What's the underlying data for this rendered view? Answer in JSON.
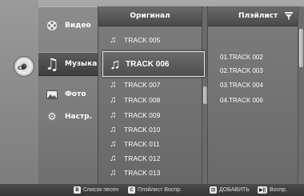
{
  "left": {
    "disc_label": "CD",
    "disc_icon": "cd-disc-icon"
  },
  "menu": {
    "items": [
      {
        "label": "Видео",
        "icon": "film-reel-icon",
        "active": false
      },
      {
        "label": "Музыка",
        "icon": "music-note-icon",
        "active": true
      },
      {
        "label": "Фото",
        "icon": "photo-icon",
        "active": false
      },
      {
        "label": "Настр.",
        "icon": "gear-icon",
        "active": false
      }
    ]
  },
  "original": {
    "title": "Оригинал",
    "tracks": [
      "TRACK 005",
      "TRACK 006",
      "TRACK 007",
      "TRACK 008",
      "TRACK 009",
      "TRACK 010",
      "TRACK 011",
      "TRACK 012",
      "TRACK 013"
    ],
    "selected_index": 1
  },
  "playlist": {
    "title": "Плэйлист",
    "items": [
      "01.TRACK 002",
      "02.TRACK 003",
      "03.TRACK 004",
      "04.TRACK 006"
    ]
  },
  "bottom_bar": {
    "hints": [
      {
        "key": "B",
        "label": "Список песен"
      },
      {
        "key": "C",
        "label": "Плэйлист Воспр."
      },
      {
        "key": "⊡",
        "label": "ДОБАВИТЬ"
      },
      {
        "key": "▶||",
        "label": "Воспр."
      }
    ]
  }
}
